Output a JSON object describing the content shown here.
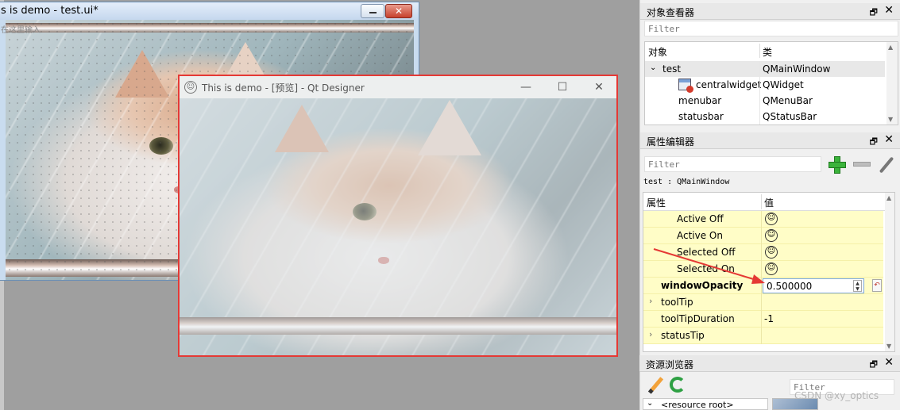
{
  "form_window": {
    "title": "s is demo - test.ui*",
    "menu_hint": "在这里输入",
    "close_glyph": "✕"
  },
  "preview_window": {
    "title": "This is demo - [预览] - Qt Designer",
    "app_icon": "☺",
    "minimize_glyph": "—",
    "maximize_glyph": "☐",
    "close_glyph": "✕",
    "border_color": "#e53935"
  },
  "object_inspector": {
    "title": "对象查看器",
    "float_glyph": "🗗",
    "close_glyph": "✕",
    "filter_placeholder": "Filter",
    "col_object": "对象",
    "col_class": "类",
    "rows": [
      {
        "name": "test",
        "class": "QMainWindow",
        "expander": "⌄"
      },
      {
        "name": "centralwidget",
        "class": "QWidget",
        "icon": "widget-error-icon"
      },
      {
        "name": "menubar",
        "class": "QMenuBar"
      },
      {
        "name": "statusbar",
        "class": "QStatusBar"
      }
    ]
  },
  "property_editor": {
    "title": "属性编辑器",
    "float_glyph": "🗗",
    "close_glyph": "✕",
    "filter_placeholder": "Filter",
    "object_line": "test : QMainWindow",
    "col_property": "属性",
    "col_value": "值",
    "rows": [
      {
        "name": "Active Off",
        "value_icon": "smiley-icon"
      },
      {
        "name": "Active On",
        "value_icon": "smiley-icon"
      },
      {
        "name": "Selected Off",
        "value_icon": "smiley-icon"
      },
      {
        "name": "Selected On",
        "value_icon": "smiley-icon"
      },
      {
        "name": "windowOpacity",
        "value": "0.500000",
        "bold": true
      },
      {
        "name": "toolTip",
        "value": "",
        "expander": "›"
      },
      {
        "name": "toolTipDuration",
        "value": "-1"
      },
      {
        "name": "statusTip",
        "value": "",
        "expander": "›"
      }
    ],
    "smiley_glyph": "☺",
    "spin_up": "▲",
    "spin_down": "▼",
    "reset_glyph": "↶"
  },
  "resource_browser": {
    "title": "资源浏览器",
    "float_glyph": "🗗",
    "close_glyph": "✕",
    "filter_placeholder": "Filter",
    "tree_root": "<resource root>",
    "tree_chevron": "⌄"
  },
  "watermark": "CSDN @xy_optics",
  "colors": {
    "annotation": "#e53935",
    "property_row_bg": "#fffdc7",
    "add_icon": "#3bb33b"
  }
}
